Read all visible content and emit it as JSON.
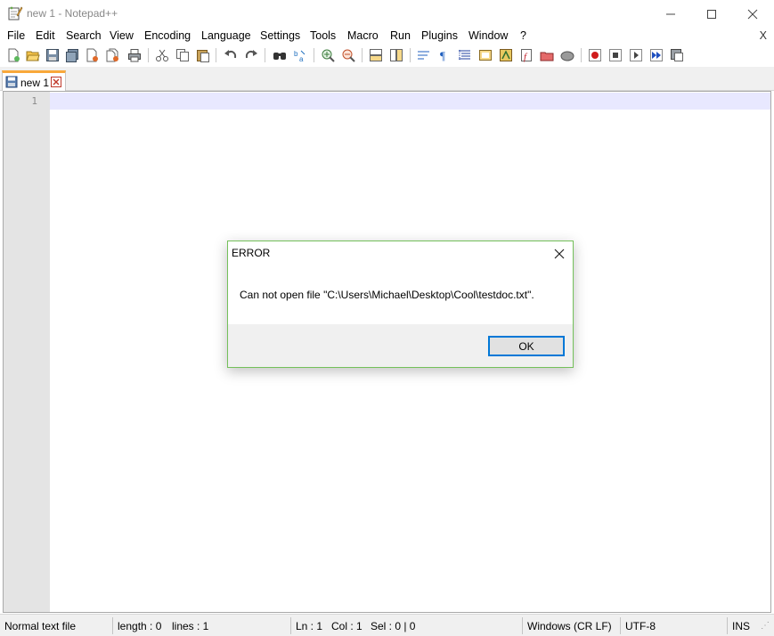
{
  "window": {
    "title": "new 1 - Notepad++",
    "minimize_glyph": "—",
    "maximize_glyph": "☐",
    "close_glyph": "✕"
  },
  "menu": {
    "items": [
      "File",
      "Edit",
      "Search",
      "View",
      "Encoding",
      "Language",
      "Settings",
      "Tools",
      "Macro",
      "Run",
      "Plugins",
      "Window",
      "?"
    ],
    "close_doc": "X"
  },
  "toolbar": {
    "icons": [
      "new-file-icon",
      "open-file-icon",
      "save-icon",
      "save-all-icon",
      "close-icon",
      "close-all-icon",
      "print-icon",
      "cut-icon",
      "copy-icon",
      "paste-icon",
      "undo-icon",
      "redo-icon",
      "find-icon",
      "replace-icon",
      "zoom-in-icon",
      "zoom-out-icon",
      "sync-vertical-icon",
      "sync-horizontal-icon",
      "word-wrap-icon",
      "show-all-chars-icon",
      "indent-guide-icon",
      "doc-map-icon",
      "function-list-icon",
      "folder-as-workspace-icon",
      "doc-list-icon",
      "monitoring-icon",
      "record-macro-icon",
      "stop-macro-icon",
      "play-macro-icon",
      "run-macro-multiple-icon",
      "save-macro-icon"
    ]
  },
  "tabs": [
    {
      "label": "new 1",
      "icon": "saved-file-icon",
      "close_icon": "tab-close-icon"
    }
  ],
  "editor": {
    "line_numbers": [
      "1"
    ],
    "content": ""
  },
  "statusbar": {
    "file_type": "Normal text file",
    "length": "length : 0",
    "lines": "lines : 1",
    "ln": "Ln : 1",
    "col": "Col : 1",
    "sel": "Sel : 0 | 0",
    "eol": "Windows (CR LF)",
    "encoding": "UTF-8",
    "mode": "INS"
  },
  "dialog": {
    "title": "ERROR",
    "message": "Can not open file \"C:\\Users\\Michael\\Desktop\\Cool\\testdoc.txt\".",
    "ok_label": "OK",
    "accent": "#74c05a",
    "ok_border": "#0078d7"
  },
  "colors": {
    "tab_accent": "#f9a83a",
    "caret_line": "#e8e8ff",
    "gutter": "#e4e4e4"
  }
}
